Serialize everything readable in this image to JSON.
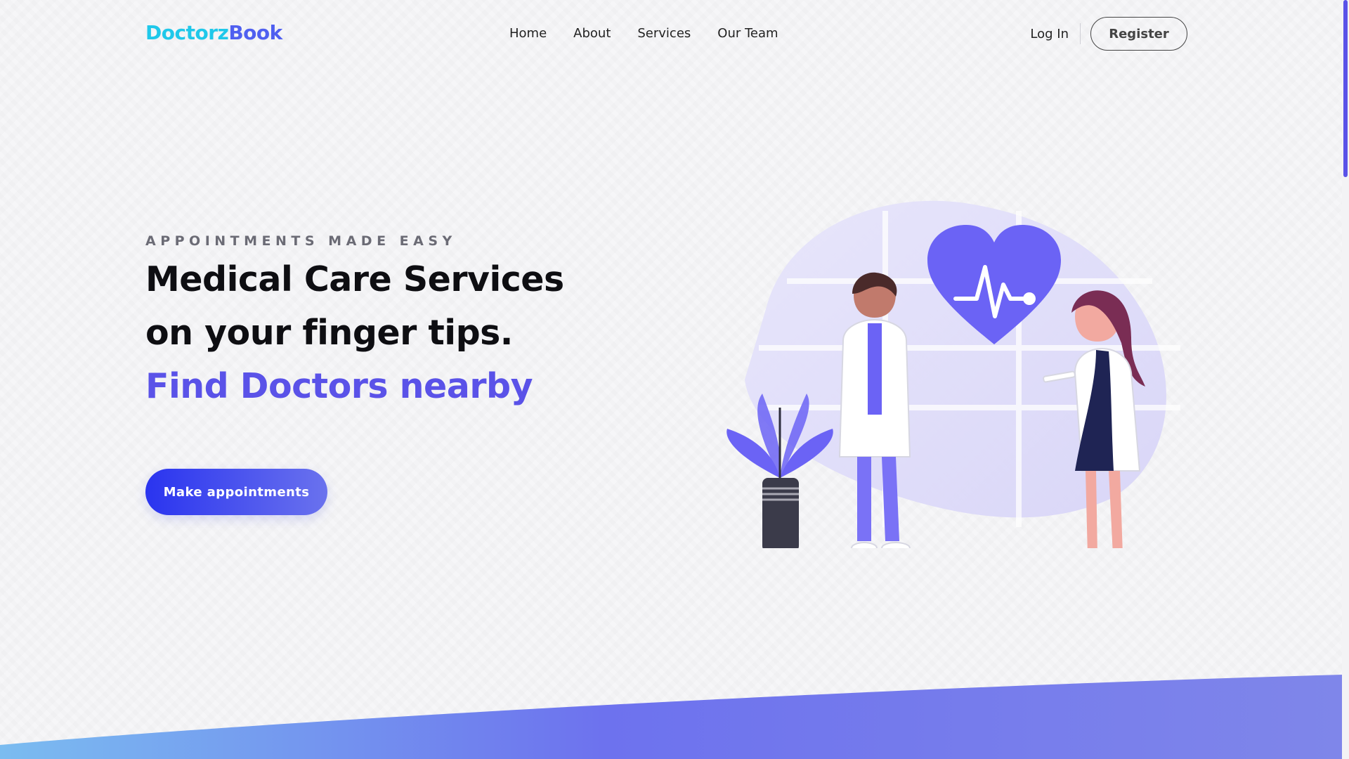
{
  "brand": {
    "name_part_a": "Doctorz",
    "name_part_b": "Book",
    "primary_color": "#5a52e8",
    "logo_gradient": [
      "#1fc8ea",
      "#4f5ff0"
    ]
  },
  "nav": {
    "items": [
      {
        "label": "Home"
      },
      {
        "label": "About"
      },
      {
        "label": "Services"
      },
      {
        "label": "Our Team"
      }
    ]
  },
  "auth": {
    "login_label": "Log In",
    "register_label": "Register"
  },
  "hero": {
    "eyebrow": "APPOINTMENTS MADE EASY",
    "title_line1": "Medical Care Services",
    "title_line2": "on your finger tips.",
    "title_accent": "Find Doctors nearby",
    "cta_label": "Make appointments"
  },
  "illustration": {
    "icons": [
      "heart-pulse-icon",
      "doctor-male-figure",
      "doctor-female-figure",
      "potted-plant"
    ]
  }
}
